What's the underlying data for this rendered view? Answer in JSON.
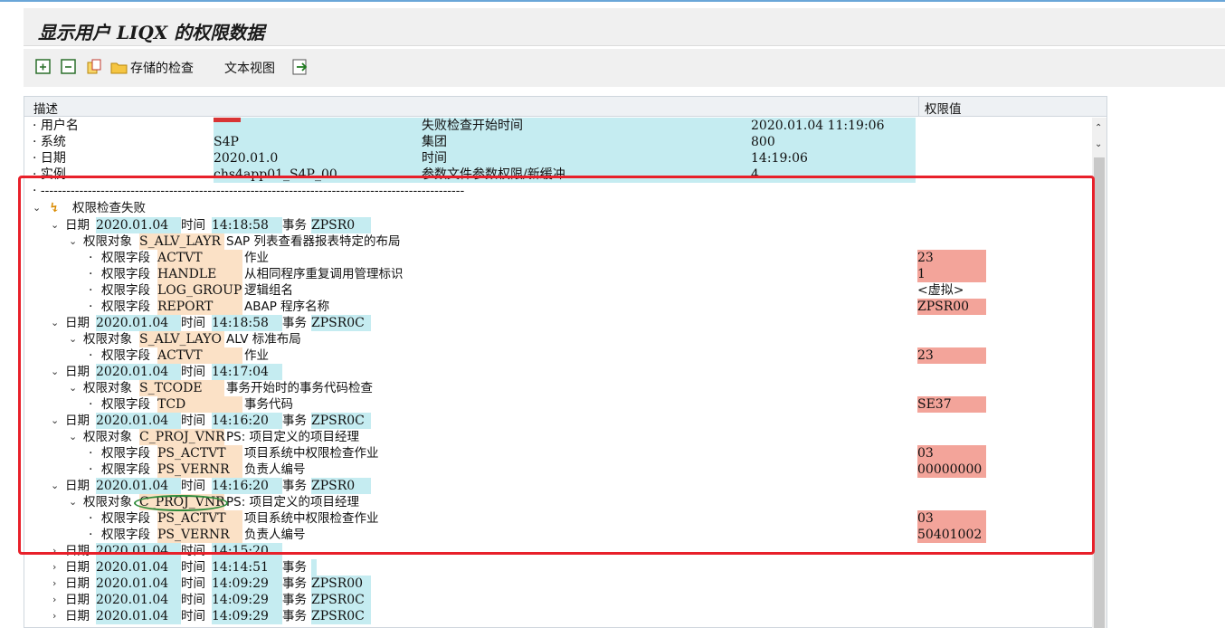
{
  "window": {
    "title": "显示用户 LIQX 的权限数据"
  },
  "toolbar": {
    "icons": [
      "expand-all-icon",
      "collapse-all-icon",
      "copy-icon",
      "folder-open-icon",
      "export-icon"
    ],
    "saved_check": "存储的检查",
    "text_view": "文本视图"
  },
  "columns": {
    "desc": "描述",
    "value": "权限值"
  },
  "header": {
    "user_label": "· 用户名",
    "system_label": "· 系统",
    "system_value": "S4P",
    "date_label": "· 日期",
    "date_value": "2020.01.0",
    "instance_label": "· 实例",
    "instance_value": "chs4app01_S4P_00",
    "fail_start_label": "失败检查开始时间",
    "fail_start_value": "2020.01.04  11:19:06",
    "group_label": "集团",
    "group_value": "800",
    "time_label": "时间",
    "time_value": "14:19:06",
    "param_label": "参数文件参数权限/新缓冲",
    "param_value": "4",
    "separator": "· ---------------------------------------------------------------------------------------------------"
  },
  "tree": {
    "root": "权限检查失败",
    "date_word": "日期",
    "time_word": "时间",
    "tx_word": "事务",
    "obj_word": "权限对象",
    "field_word": "权限字段",
    "entries": [
      {
        "date": "2020.01.04",
        "time": "14:18:58",
        "tx": "ZPSR0",
        "object": "S_ALV_LAYR",
        "object_desc": "SAP 列表查看器报表特定的布局",
        "fields": [
          {
            "name": "ACTVT",
            "desc": "作业",
            "value": "23"
          },
          {
            "name": "HANDLE",
            "desc": "从相同程序重复调用管理标识",
            "value": "1"
          },
          {
            "name": "LOG_GROUP",
            "desc": "逻辑组名",
            "value": "<虚拟>"
          },
          {
            "name": "REPORT",
            "desc": "ABAP 程序名称",
            "value": "ZPSR00"
          }
        ]
      },
      {
        "date": "2020.01.04",
        "time": "14:18:58",
        "tx": "ZPSR0C",
        "object": "S_ALV_LAYO",
        "object_desc": "ALV 标准布局",
        "fields": [
          {
            "name": "ACTVT",
            "desc": "作业",
            "value": "23"
          }
        ]
      },
      {
        "date": "2020.01.04",
        "time": "14:17:04",
        "tx": "",
        "object": "S_TCODE",
        "object_desc": "事务开始时的事务代码检查",
        "fields": [
          {
            "name": "TCD",
            "desc": "事务代码",
            "value": "SE37"
          }
        ]
      },
      {
        "date": "2020.01.04",
        "time": "14:16:20",
        "tx": "ZPSR0C",
        "object": "C_PROJ_VNR",
        "object_desc": "PS: 项目定义的项目经理",
        "fields": [
          {
            "name": "PS_ACTVT",
            "desc": "项目系统中权限检查作业",
            "value": "03"
          },
          {
            "name": "PS_VERNR",
            "desc": "负责人编号",
            "value": "00000000"
          }
        ]
      },
      {
        "date": "2020.01.04",
        "time": "14:16:20",
        "tx": "ZPSR0",
        "object": "C_PROJ_VNR",
        "object_desc": "PS: 项目定义的项目经理",
        "fields": [
          {
            "name": "PS_ACTVT",
            "desc": "项目系统中权限检查作业",
            "value": "03"
          },
          {
            "name": "PS_VERNR",
            "desc": "负责人编号",
            "value": "50401002"
          }
        ]
      }
    ],
    "collapsed": [
      {
        "date": "2020.01.04",
        "time": "14:15:20",
        "tx": ""
      },
      {
        "date": "2020.01.04",
        "time": "14:14:51",
        "tx": "事务"
      },
      {
        "date": "2020.01.04",
        "time": "14:09:29",
        "tx": "ZPSR00"
      },
      {
        "date": "2020.01.04",
        "time": "14:09:29",
        "tx": "ZPSR0C"
      },
      {
        "date": "2020.01.04",
        "time": "14:09:29",
        "tx": "ZPSR0C"
      }
    ]
  },
  "colors": {
    "cyan": "#c5ecf1",
    "tan": "#fbe1c6",
    "pink": "#f3a49a",
    "highlight_box": "#e8202a"
  }
}
